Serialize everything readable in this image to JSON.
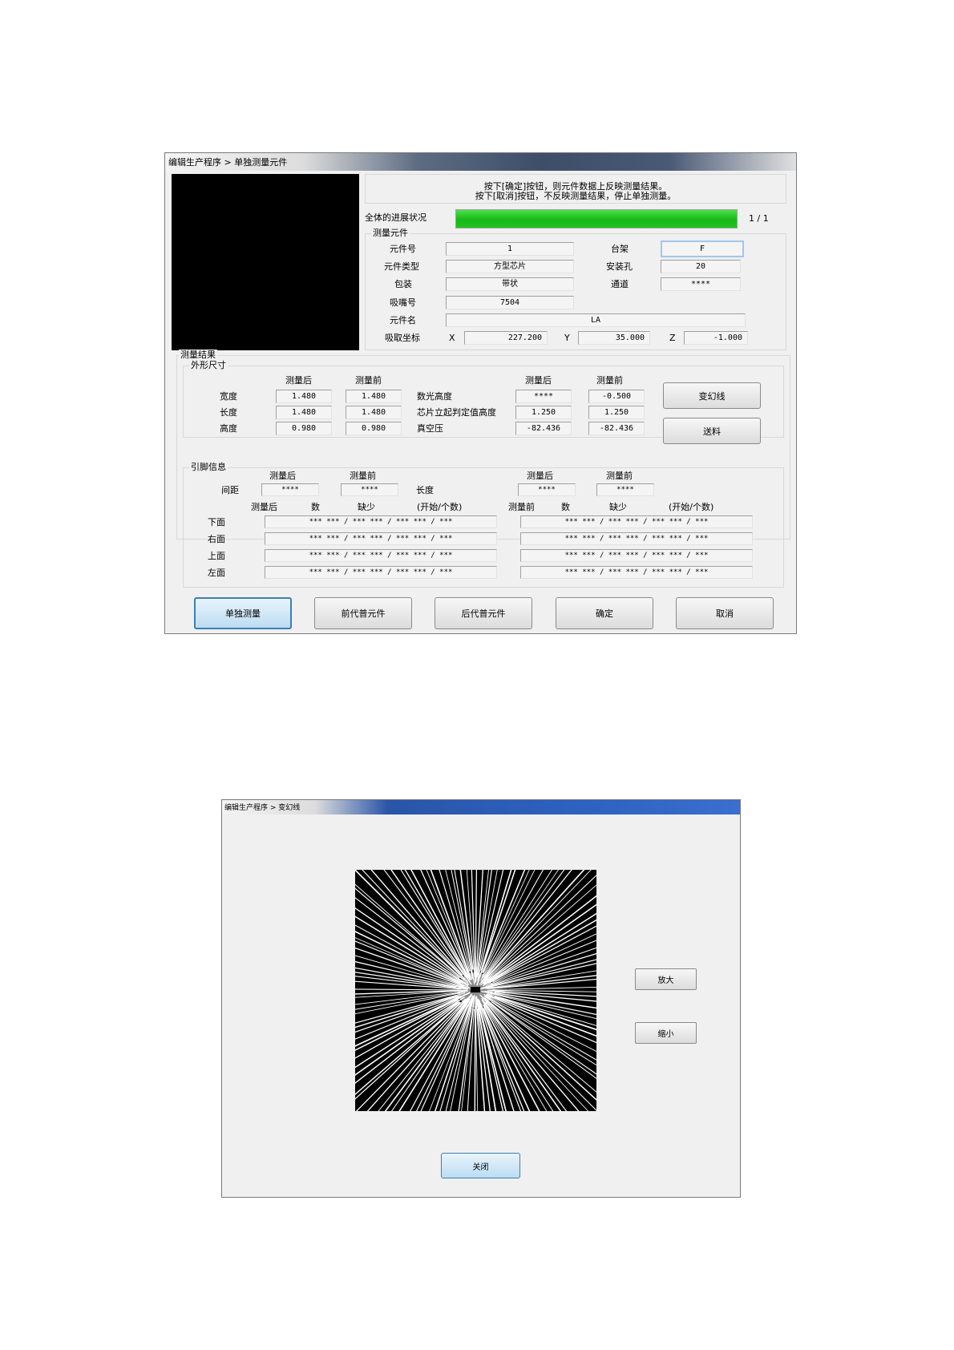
{
  "dialog1": {
    "title": "编辑生产程序 > 单独测量元件",
    "message_line1": "按下[确定]按钮，则元件数据上反映测量结果。",
    "message_line2": "按下[取消]按钮，不反映测量结果，停止单独测量。",
    "progress_label": "全体的进展状况",
    "progress_fraction": 1.0,
    "progress_text": "1 / 1",
    "component_group": {
      "legend": "测量元件",
      "part_no_label": "元件号",
      "part_no": "1",
      "type_label": "元件类型",
      "type": "方型芯片",
      "package_label": "包装",
      "package": "带状",
      "nozzle_label": "吸嘴号",
      "nozzle": "7504",
      "name_label": "元件名",
      "name": "LA",
      "pick_label": "吸取坐标",
      "x_label": "X",
      "x": "227.200",
      "y_label": "Y",
      "y": "35.000",
      "z_label": "Z",
      "z": "-1.000",
      "table_label": "台架",
      "table": "F",
      "hole_label": "安装孔",
      "hole": "20",
      "channel_label": "通道",
      "channel": "****"
    },
    "result_group": {
      "legend": "测量结果",
      "shape_legend": "外形尺寸",
      "after_label": "测量后",
      "before_label": "测量前",
      "rows": [
        {
          "label": "宽度",
          "after": "1.480",
          "before": "1.480"
        },
        {
          "label": "长度",
          "after": "1.480",
          "before": "1.480"
        },
        {
          "label": "高度",
          "after": "0.980",
          "before": "0.980"
        }
      ],
      "rows2": [
        {
          "label": "数光高度",
          "after": "****",
          "before": "-0.500"
        },
        {
          "label": "芯片立起判定值高度",
          "after": "1.250",
          "before": "1.250"
        },
        {
          "label": "真空压",
          "after": "-82.436",
          "before": "-82.436"
        }
      ],
      "btn_change_light": "变幻线",
      "btn_feed": "送料"
    },
    "lead_group": {
      "legend": "引脚信息",
      "after_label": "测量后",
      "before_label": "测量前",
      "pitch_label": "间距",
      "pitch_after": "****",
      "pitch_before": "****",
      "length_label": "长度",
      "length_after": "****",
      "length_before": "****",
      "hdr_after": "测量后",
      "hdr_count": "数",
      "hdr_missing": "缺少",
      "hdr_start": "(开始/个数)",
      "hdr_before": "测量前",
      "sides": [
        {
          "label": "下面",
          "after": "*** *** / *** *** / *** *** / ***",
          "before": "*** *** / *** *** / *** *** / ***"
        },
        {
          "label": "右面",
          "after": "*** *** / *** *** / *** *** / ***",
          "before": "*** *** / *** *** / *** *** / ***"
        },
        {
          "label": "上面",
          "after": "*** *** / *** *** / *** *** / ***",
          "before": "*** *** / *** *** / *** *** / ***"
        },
        {
          "label": "左面",
          "after": "*** *** / *** *** / *** *** / ***",
          "before": "*** *** / *** *** / *** *** / ***"
        }
      ]
    },
    "buttons": [
      "单独测量",
      "前代普元件",
      "后代普元件",
      "确定",
      "取消"
    ]
  },
  "dialog2": {
    "title": "编辑生产程序 > 变幻线",
    "zoom_in": "放大",
    "zoom_out": "缩小",
    "close": "关闭"
  },
  "colors": {
    "progress": "#1ec41e",
    "accent": "#3c7fb1"
  }
}
